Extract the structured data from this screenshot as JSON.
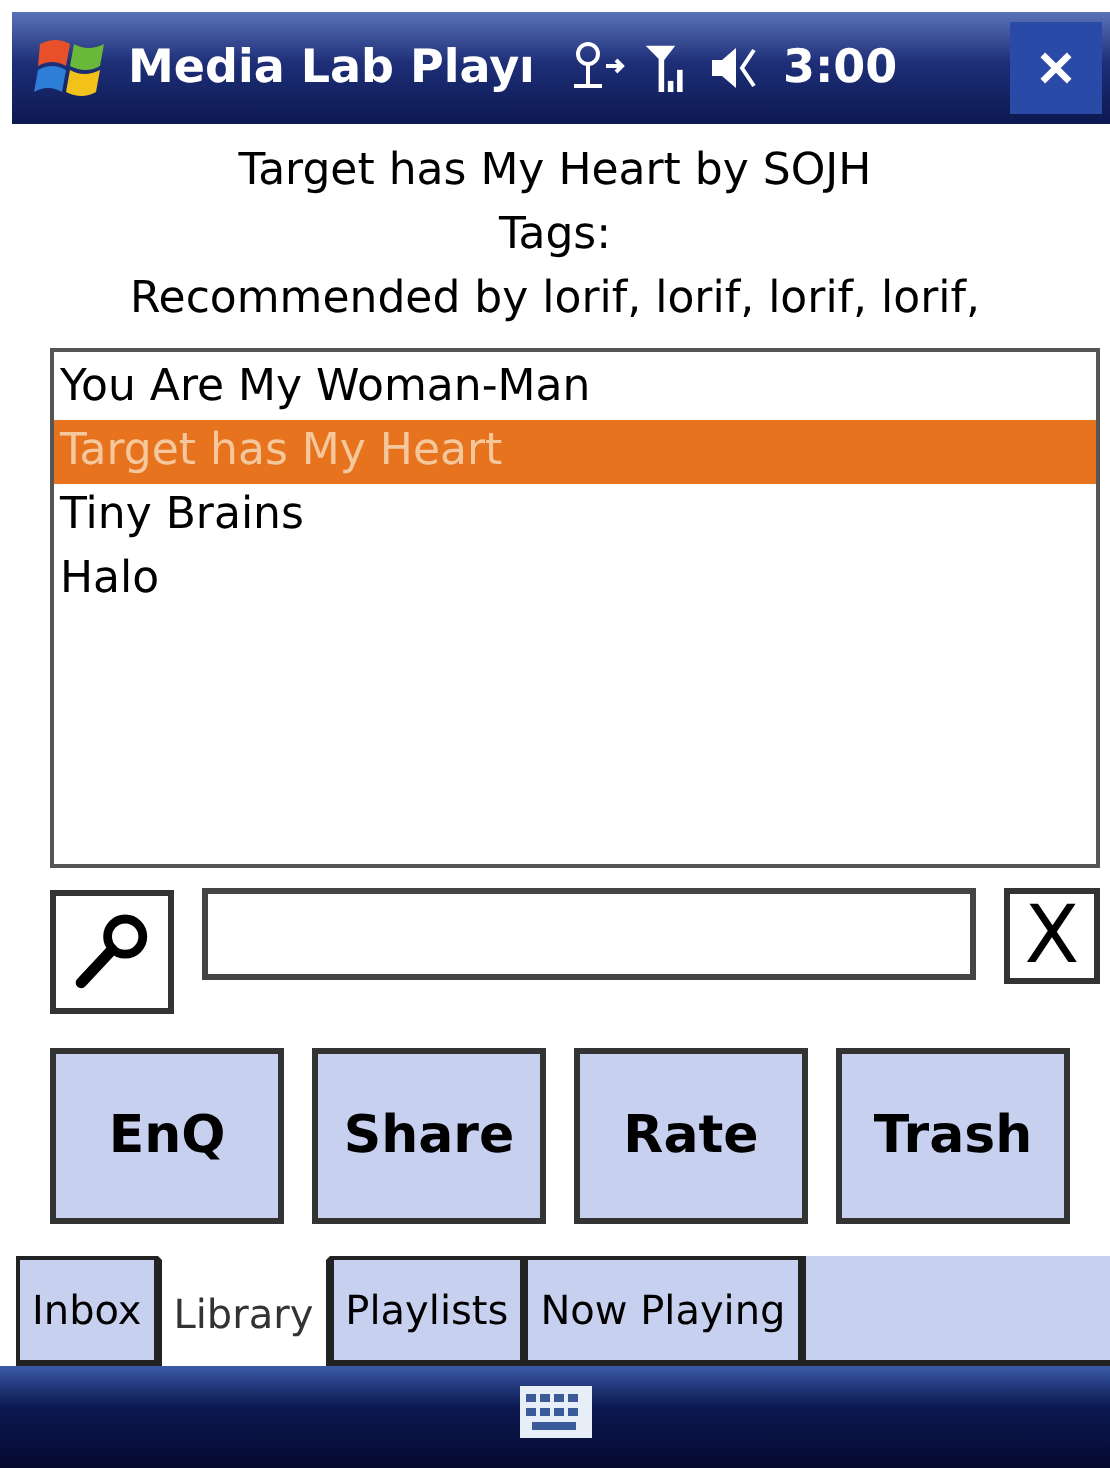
{
  "title_bar": {
    "title": "Media Lab Playı",
    "time": "3:00"
  },
  "now_playing": {
    "song": "Target has My Heart by SOJH",
    "tags": "Tags:",
    "recommended": "Recommended by lorif, lorif, lorif, lorif,"
  },
  "song_list": [
    {
      "title": "You Are My Woman-Man",
      "selected": false
    },
    {
      "title": "Target has My Heart",
      "selected": true
    },
    {
      "title": "Tiny Brains",
      "selected": false
    },
    {
      "title": "Halo",
      "selected": false
    }
  ],
  "search": {
    "clear_label": "X"
  },
  "buttons": [
    "EnQ",
    "Share",
    "Rate",
    "Trash"
  ],
  "tabs": [
    {
      "label": "Inbox",
      "selected": false
    },
    {
      "label": "Library",
      "selected": true
    },
    {
      "label": "Playlists",
      "selected": false
    },
    {
      "label": "Now Playing",
      "selected": false
    }
  ]
}
